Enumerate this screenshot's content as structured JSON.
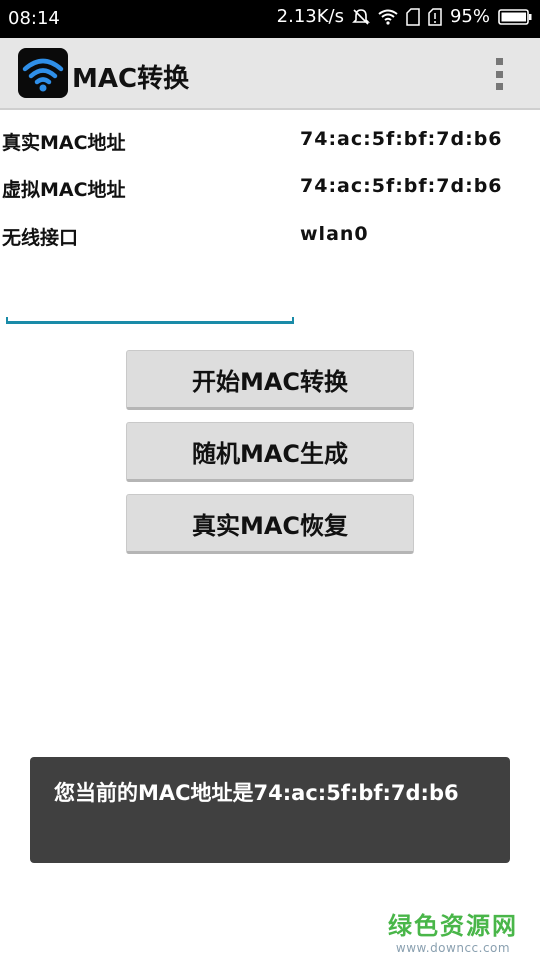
{
  "status_bar": {
    "time": "08:14",
    "network_speed": "2.13K/s",
    "battery": "95%"
  },
  "app_bar": {
    "title": "MAC转换",
    "overflow_icon": "more-vert-icon"
  },
  "info": {
    "real_mac_label": "真实MAC地址",
    "real_mac_value": "74:ac:5f:bf:7d:b6",
    "virtual_mac_label": "虚拟MAC地址",
    "virtual_mac_value": "74:ac:5f:bf:7d:b6",
    "interface_label": "无线接口",
    "interface_value": "wlan0"
  },
  "input": {
    "value": "",
    "placeholder": ""
  },
  "buttons": {
    "start_label": "开始MAC转换",
    "random_label": "随机MAC生成",
    "restore_label": "真实MAC恢复"
  },
  "toast": {
    "message": "您当前的MAC地址是74:ac:5f:bf:7d:b6"
  },
  "watermark": {
    "name": "绿色资源网",
    "url": "www.downcc.com"
  },
  "colors": {
    "accent": "#1a8ba8",
    "app_bar": "#e6e6e6",
    "toast": "#404040",
    "watermark": "#49b649"
  }
}
